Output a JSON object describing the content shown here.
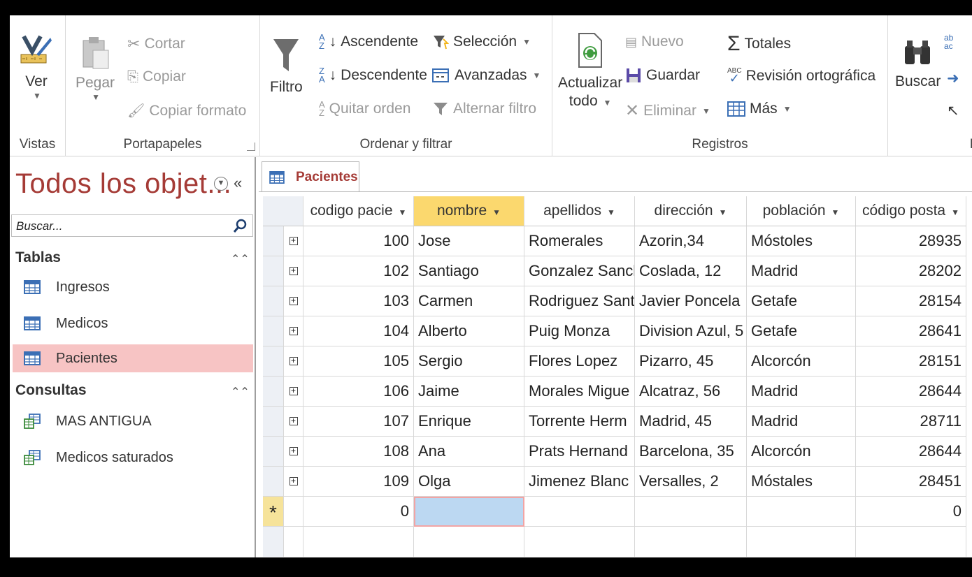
{
  "ribbon": {
    "vistas": {
      "label": "Vistas",
      "ver": "Ver"
    },
    "portapapeles": {
      "label": "Portapapeles",
      "pegar": "Pegar",
      "cortar": "Cortar",
      "copiar": "Copiar",
      "copiar_formato": "Copiar formato"
    },
    "ordenar": {
      "label": "Ordenar y filtrar",
      "filtro": "Filtro",
      "ascendente": "Ascendente",
      "descendente": "Descendente",
      "quitar_orden": "Quitar orden",
      "seleccion": "Selección",
      "avanzadas": "Avanzadas",
      "alternar_filtro": "Alternar filtro"
    },
    "registros": {
      "label": "Registros",
      "actualizar_1": "Actualizar",
      "actualizar_2": "todo",
      "nuevo": "Nuevo",
      "guardar": "Guardar",
      "eliminar": "Eliminar",
      "totales": "Totales",
      "revision": "Revisión ortográfica",
      "mas": "Más"
    },
    "buscar": {
      "label": "Bu",
      "buscar": "Buscar"
    }
  },
  "nav": {
    "title": "Todos los objet...",
    "search_placeholder": "Buscar...",
    "sections": [
      {
        "label": "Tablas",
        "items": [
          "Ingresos",
          "Medicos",
          "Pacientes"
        ]
      },
      {
        "label": "Consultas",
        "items": [
          "MAS ANTIGUA",
          "Medicos saturados"
        ]
      }
    ]
  },
  "doc": {
    "tab": "Pacientes",
    "columns": [
      "codigo pacie",
      "nombre",
      "apellidos",
      "dirección",
      "población",
      "código posta"
    ],
    "rows": [
      [
        "100",
        "Jose",
        "Romerales",
        "Azorin,34",
        "Móstoles",
        "28935"
      ],
      [
        "102",
        "Santiago",
        "Gonzalez Sancl",
        "Coslada, 12",
        "Madrid",
        "28202"
      ],
      [
        "103",
        "Carmen",
        "Rodriguez Sant",
        "Javier Poncela",
        "Getafe",
        "28154"
      ],
      [
        "104",
        "Alberto",
        "Puig Monza",
        "Division Azul, 5",
        "Getafe",
        "28641"
      ],
      [
        "105",
        "Sergio",
        "Flores Lopez",
        "Pizarro, 45",
        "Alcorcón",
        "28151"
      ],
      [
        "106",
        "Jaime",
        "Morales Migue",
        "Alcatraz, 56",
        "Madrid",
        "28644"
      ],
      [
        "107",
        "Enrique",
        "Torrente Herm",
        "Madrid, 45",
        "Madrid",
        "28711"
      ],
      [
        "108",
        "Ana",
        "Prats Hernand",
        "Barcelona, 35",
        "Alcorcón",
        "28644"
      ],
      [
        "109",
        "Olga",
        "Jimenez Blanc",
        "Versalles, 2",
        "Móstales",
        "28451"
      ]
    ],
    "new_row": {
      "marker": "*",
      "codigo": "0",
      "postal": "0"
    }
  },
  "colors": {
    "accent": "#a53b36",
    "selected_nav": "#f7c4c4",
    "selected_header": "#fbd86e",
    "active_cell": "#bcd8f2"
  }
}
